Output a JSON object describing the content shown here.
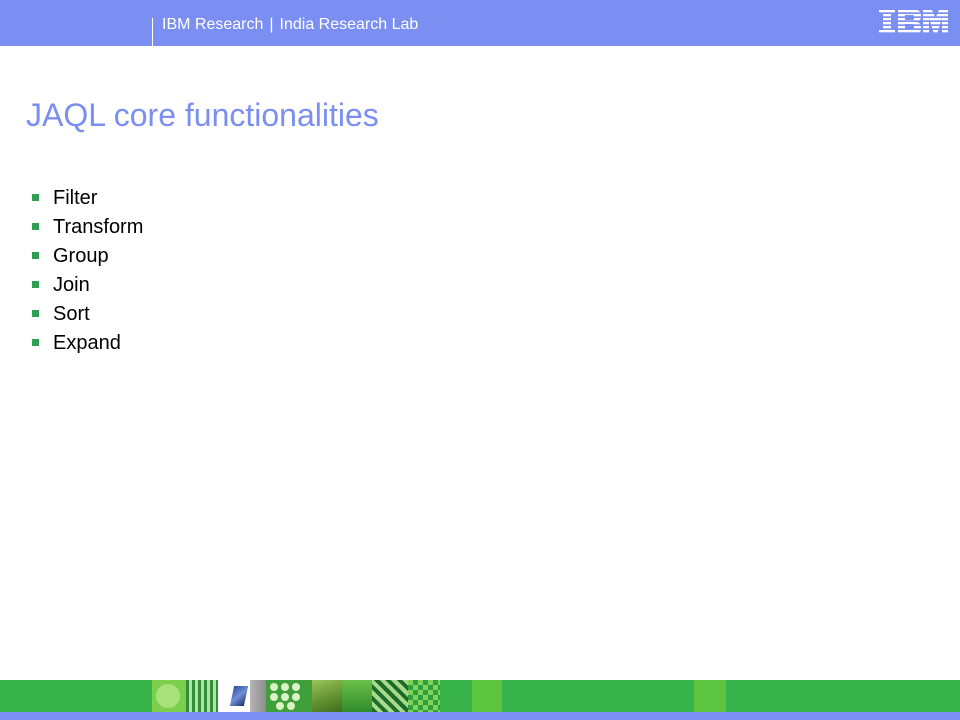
{
  "header": {
    "org": "IBM Research",
    "separator": "|",
    "lab": "India Research Lab",
    "logo_text": "IBM"
  },
  "slide": {
    "title": "JAQL core functionalities",
    "bullets": [
      "Filter",
      "Transform",
      "Group",
      "Join",
      "Sort",
      "Expand"
    ]
  },
  "colors": {
    "header_bar": "#7b8ff2",
    "title": "#7b8ff2",
    "bullet_marker": "#2f9e52",
    "footer_band": "#37b34a"
  }
}
